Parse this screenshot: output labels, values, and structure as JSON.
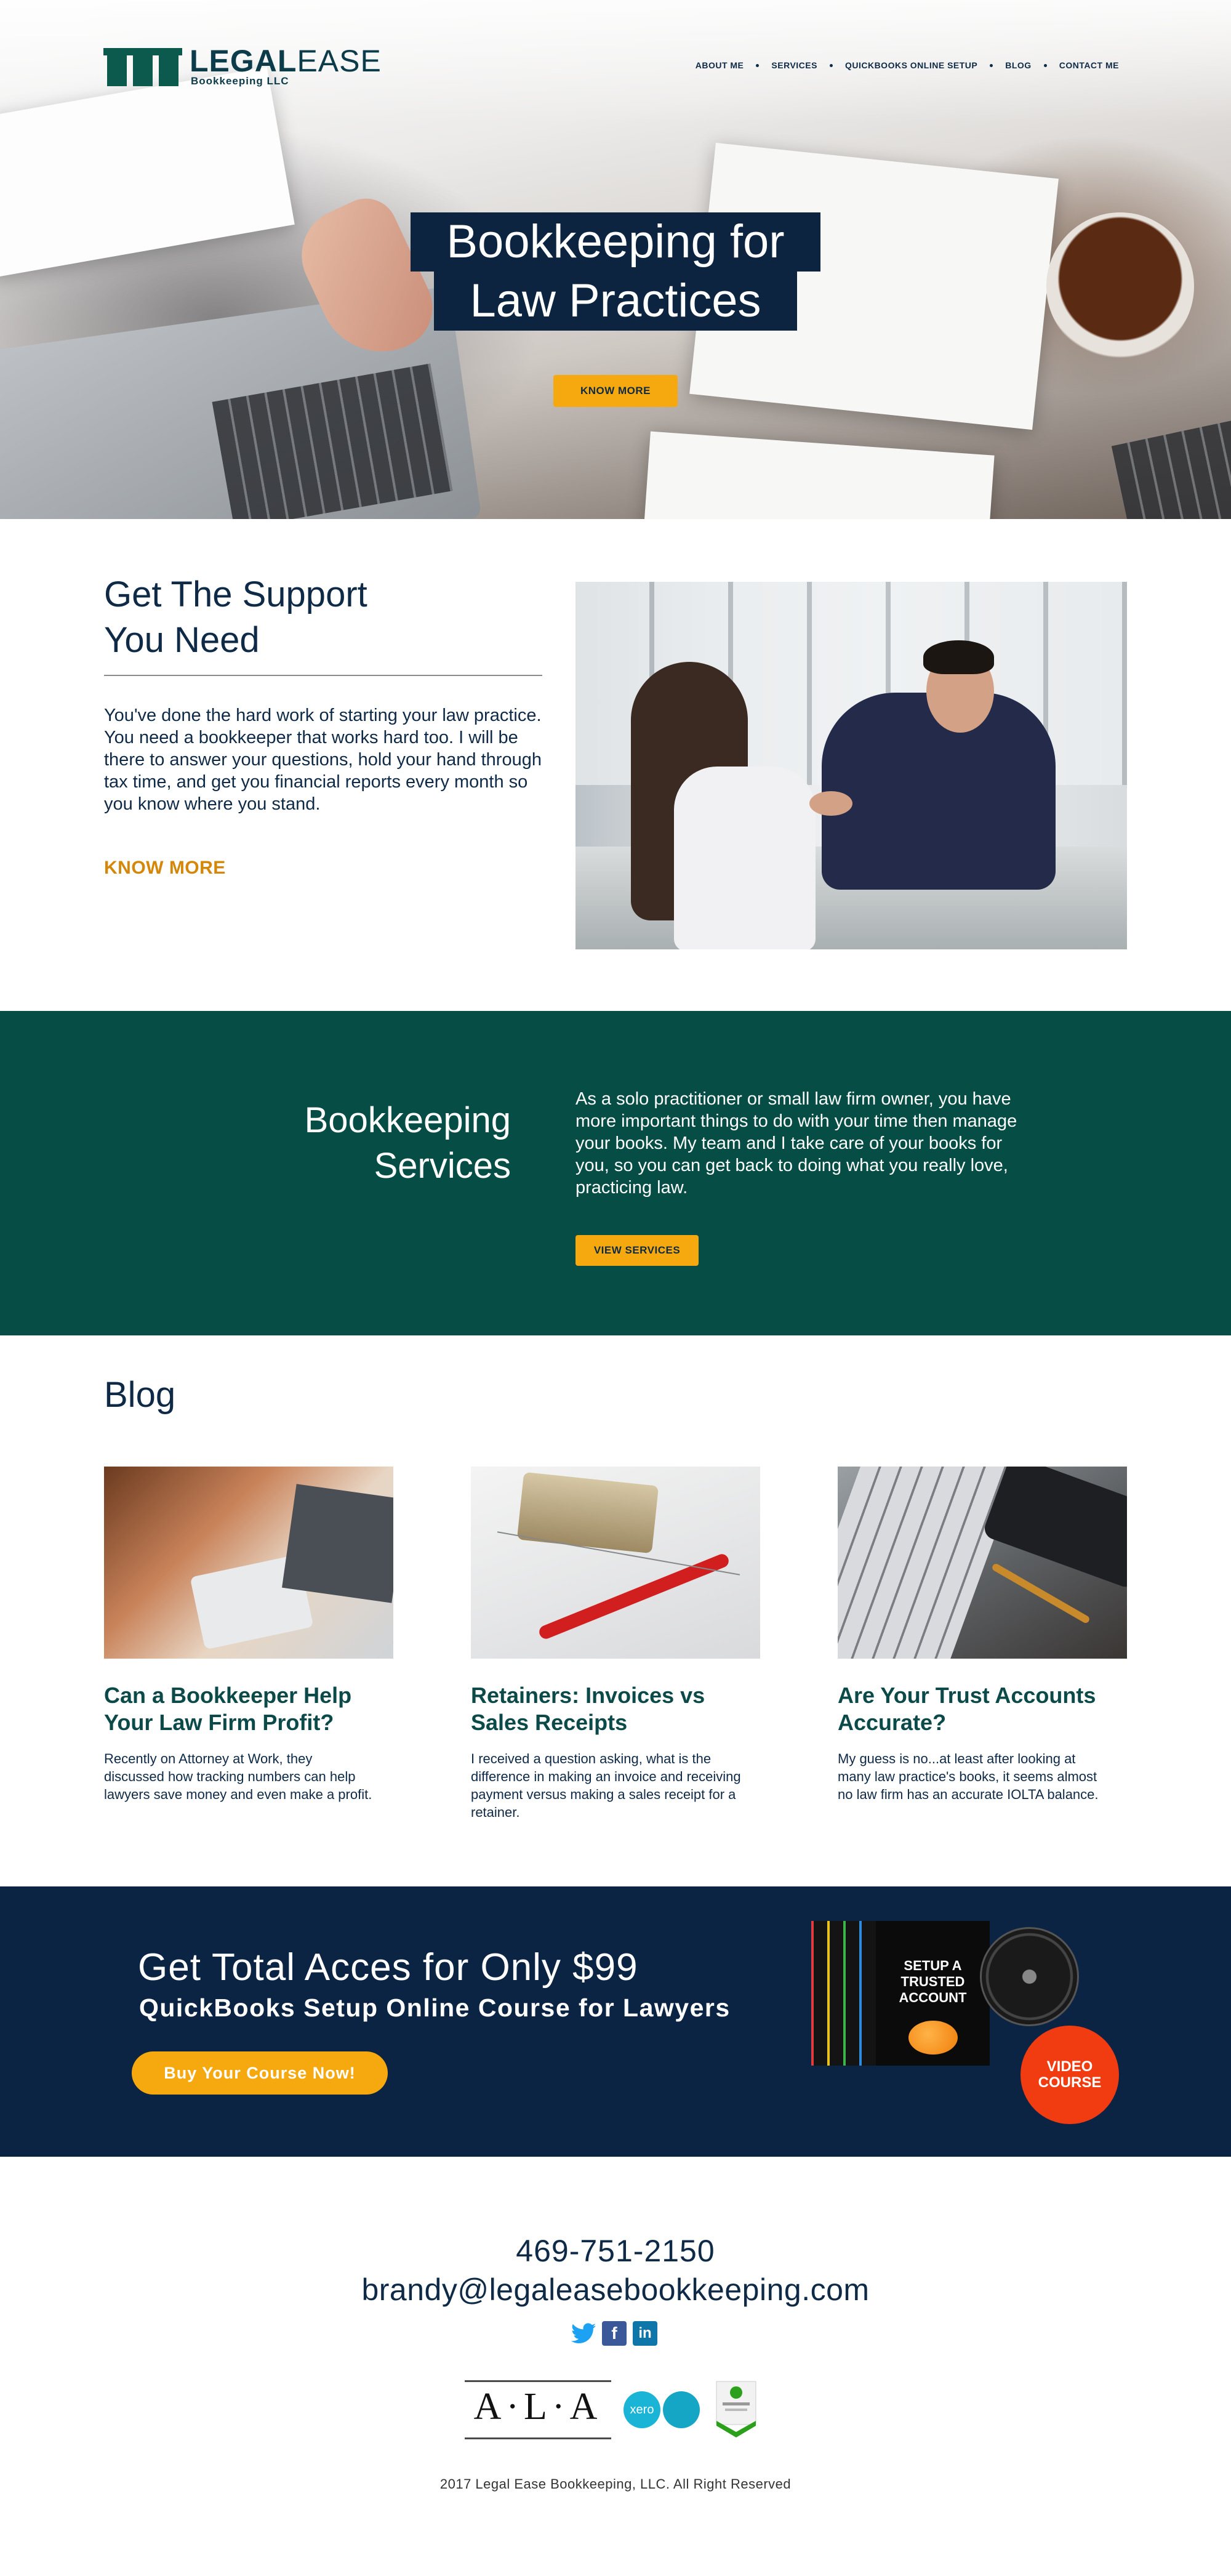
{
  "brand": {
    "name_bold": "LEGAL",
    "name_light": "EASE",
    "tagline": "Bookkeeping LLC"
  },
  "nav": {
    "items": [
      "ABOUT ME",
      "SERVICES",
      "QUICKBOOKS ONLINE SETUP",
      "BLOG",
      "CONTACT ME"
    ]
  },
  "hero": {
    "title_line1": "Bookkeeping for",
    "title_line2": "Law Practices",
    "button": "KNOW MORE"
  },
  "support": {
    "title_line1": "Get The Support",
    "title_line2": "You Need",
    "body": "You've done the hard work of starting your law practice. You need a bookkeeper that works hard too. I will be there to answer your questions, hold your hand through tax time, and get you financial reports every month so you know where you stand.",
    "link": "KNOW MORE"
  },
  "services": {
    "title_line1": "Bookkeeping",
    "title_line2": "Services",
    "body": "As a solo practitioner or small law firm owner, you have more important things to do with your time then manage your books. My team and I take care of your books for you, so you can get back to doing what you really love, practicing law.",
    "button": "VIEW SERVICES"
  },
  "blog": {
    "title": "Blog",
    "posts": [
      {
        "title": "Can a Bookkeeper Help Your Law Firm Profit?",
        "excerpt": "Recently on Attorney at Work, they discussed how tracking numbers can help lawyers save money and even make a profit."
      },
      {
        "title": "Retainers: Invoices vs Sales Receipts",
        "excerpt": "I received a question asking, what is the difference in making an invoice and receiving payment versus making a sales receipt for a retainer."
      },
      {
        "title": "Are Your Trust Accounts Accurate?",
        "excerpt": "My guess is no...at least after looking at many law practice's books, it seems almost no law firm has an accurate IOLTA balance."
      }
    ]
  },
  "course": {
    "headline": "Get Total Acces for Only $99",
    "subheadline": "QuickBooks Setup Online Course for Lawyers",
    "button": "Buy Your Course Now!",
    "box_label": "SETUP A TRUSTED ACCOUNT",
    "badge_line1": "VIDEO",
    "badge_line2": "COURSE"
  },
  "footer": {
    "phone": "469-751-2150",
    "email": "brandy@legaleasebookkeeping.com",
    "social_icons": [
      "twitter-icon",
      "facebook-icon",
      "linkedin-icon"
    ],
    "ala_logo_text": "A·L·A",
    "xero_logo_text": "xero",
    "copyright": "2017 Legal Ease Bookkeeping, LLC. All Right Reserved"
  },
  "colors": {
    "navy": "#0e2a47",
    "teal": "#064d46",
    "accent": "#f6a90f",
    "course_bg": "#0b2444",
    "badge_red": "#f03c10"
  }
}
